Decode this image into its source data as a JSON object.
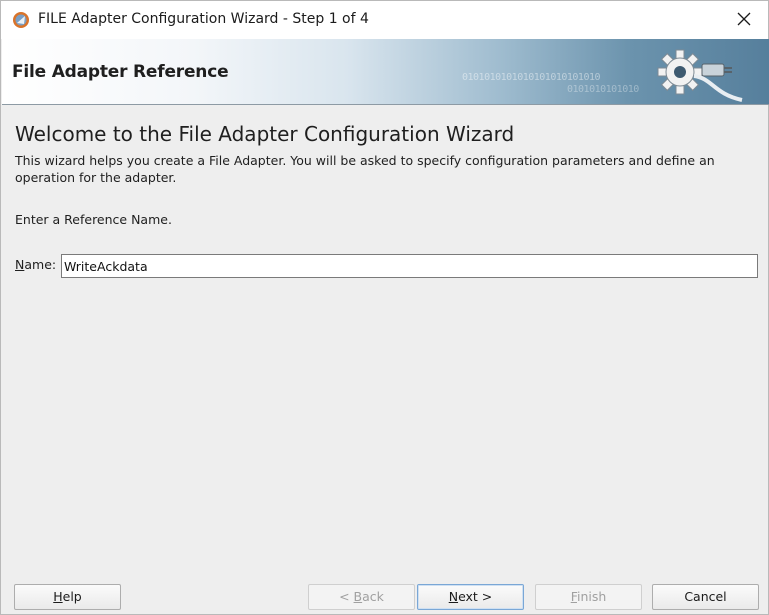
{
  "window": {
    "title": "FILE Adapter Configuration Wizard - Step 1 of 4"
  },
  "banner": {
    "title": "File Adapter Reference",
    "binary_line1": "0101010101010101010101010",
    "binary_line2": "0101010101010"
  },
  "content": {
    "heading": "Welcome to the File Adapter Configuration Wizard",
    "description": "This wizard helps you create a File Adapter. You will be asked to specify configuration parameters and define an operation for the adapter.",
    "prompt": "Enter a Reference Name.",
    "name_label_mnemonic": "N",
    "name_label_rest": "ame:",
    "name_value": "WriteAckdata"
  },
  "buttons": {
    "help_mnemonic": "H",
    "help_rest": "elp",
    "back_prefix": "< ",
    "back_mnemonic": "B",
    "back_rest": "ack",
    "next_mnemonic": "N",
    "next_rest": "ext >",
    "finish_mnemonic": "F",
    "finish_rest": "inish",
    "cancel": "Cancel"
  },
  "icons": {
    "app": "jdeveloper-icon",
    "close": "close-icon",
    "banner": "gear-plug-icon"
  },
  "colors": {
    "banner_dark": "#567f9c",
    "default_button_border": "#7aa7d6"
  }
}
